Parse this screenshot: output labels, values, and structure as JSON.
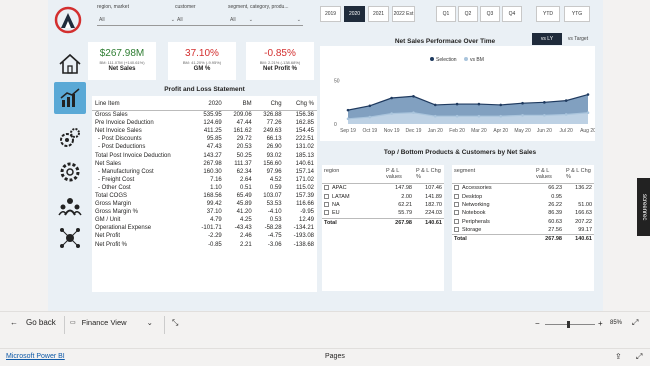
{
  "slicers": [
    {
      "label": "region, market",
      "value": "All"
    },
    {
      "label": "customer",
      "value": "All"
    },
    {
      "label": "segment, category, produ...",
      "value": "All"
    }
  ],
  "years": [
    "2019",
    "2020",
    "2021",
    "2022 Est"
  ],
  "selected_year": "2020",
  "quarters": [
    "Q1",
    "Q2",
    "Q3",
    "Q4"
  ],
  "periods": [
    "YTD",
    "YTG"
  ],
  "kpis": [
    {
      "value": "$267.98M",
      "bm": "BM: 111.07M (+140.61%)",
      "title": "Net Sales",
      "color": "#2e7d32"
    },
    {
      "value": "37.10%",
      "bm": "BM: 41.20% (-9.95%)",
      "title": "GM %",
      "color": "#d32f2f"
    },
    {
      "value": "-0.85%",
      "bm": "BM: 2.21% (-138.68%)",
      "title": "Net Profit %",
      "color": "#d32f2f"
    }
  ],
  "pl": {
    "title": "Profit and Loss Statement",
    "headers": [
      "Line Item",
      "2020",
      "BM",
      "Chg",
      "Chg %"
    ],
    "rows": [
      [
        "Gross Sales",
        "535.95",
        "209.06",
        "326.88",
        "156.36"
      ],
      [
        "Pre Invoice Deduction",
        "124.69",
        "47.44",
        "77.26",
        "162.85"
      ],
      [
        "Net Invoice Sales",
        "411.25",
        "161.62",
        "249.63",
        "154.45"
      ],
      [
        " - Post Discounts",
        "95.85",
        "29.72",
        "66.13",
        "222.51"
      ],
      [
        " - Post Deductions",
        "47.43",
        "20.53",
        "26.90",
        "131.02"
      ],
      [
        "Total Post Invoice Deduction",
        "143.27",
        "50.25",
        "93.02",
        "185.13"
      ],
      [
        "Net Sales",
        "267.98",
        "111.37",
        "156.60",
        "140.61"
      ],
      [
        " - Manufacturing Cost",
        "160.30",
        "62.34",
        "97.96",
        "157.14"
      ],
      [
        " - Freight Cost",
        "7.16",
        "2.64",
        "4.52",
        "171.02"
      ],
      [
        " - Other Cost",
        "1.10",
        "0.51",
        "0.59",
        "115.02"
      ],
      [
        "Total COGS",
        "168.56",
        "65.49",
        "103.07",
        "157.39"
      ],
      [
        "Gross Margin",
        "99.42",
        "45.89",
        "53.53",
        "116.66"
      ],
      [
        "Gross Margin %",
        "37.10",
        "41.20",
        "-4.10",
        "-9.95"
      ],
      [
        "GM / Unit",
        "4.79",
        "4.25",
        "0.53",
        "12.49"
      ],
      [
        "Operational Expense",
        "-101.71",
        "-43.43",
        "-58.28",
        "-134.21"
      ],
      [
        "Net Profit",
        "-2.29",
        "2.46",
        "-4.75",
        "-193.08"
      ],
      [
        "Net Profit %",
        "-0.85",
        "2.21",
        "-3.06",
        "-138.68"
      ]
    ]
  },
  "chart": {
    "title": "Net Sales Performace Over Time",
    "toggle_on": "vs LY",
    "toggle_off": "vs Target"
  },
  "chart_data": {
    "type": "area",
    "x": [
      "Sep 19",
      "Oct 19",
      "Nov 19",
      "Dec 19",
      "Jan 20",
      "Feb 20",
      "Mar 20",
      "Apr 20",
      "May 20",
      "Jun 20",
      "Jul 20",
      "Aug 20"
    ],
    "series": [
      {
        "name": "Selection",
        "values": [
          16,
          21,
          30,
          32,
          22,
          23,
          23,
          22,
          24,
          25,
          27,
          34
        ]
      },
      {
        "name": "vs BM",
        "values": [
          6,
          8,
          12,
          13,
          9,
          9,
          9,
          9,
          10,
          10,
          11,
          13
        ]
      }
    ],
    "ylim": [
      0,
      60
    ],
    "yticks": [
      "50",
      "0"
    ],
    "legend": "top"
  },
  "topbottom": {
    "title": "Top / Bottom Products & Customers by Net Sales",
    "region": {
      "headers": [
        "region",
        "P & L values",
        "P & L Chg %"
      ],
      "rows": [
        [
          "APAC",
          "147.98",
          "107.46"
        ],
        [
          "LATAM",
          "2.00",
          "141.89"
        ],
        [
          "NA",
          "62.21",
          "182.70"
        ],
        [
          "EU",
          "55.79",
          "224.03"
        ]
      ],
      "total": [
        "Total",
        "267.98",
        "140.61"
      ]
    },
    "segment": {
      "headers": [
        "segment",
        "P & L values",
        "P & L Chg %"
      ],
      "rows": [
        [
          "Accessories",
          "66.23",
          "136.22"
        ],
        [
          "Desktop",
          "0.95",
          ""
        ],
        [
          "Networking",
          "26.22",
          "51.00"
        ],
        [
          "Notebook",
          "86.39",
          "166.63"
        ],
        [
          "Peripherals",
          "60.63",
          "207.22"
        ],
        [
          "Storage",
          "27.56",
          "99.17"
        ]
      ],
      "total": [
        "Total",
        "267.98",
        "140.61"
      ]
    }
  },
  "screenrec": "screenrec",
  "footer_nav": {
    "back": "Go back",
    "view": "Finance View"
  },
  "zoom": "85%",
  "status": {
    "app": "Microsoft Power BI",
    "pages": "Pages"
  }
}
